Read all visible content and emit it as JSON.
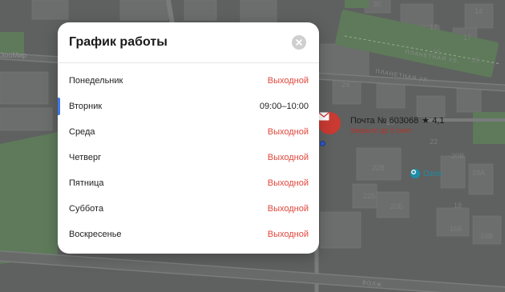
{
  "map": {
    "top_left_label": "ЗооМир",
    "streets": [
      "ПЛАНЕТНАЯ УЛ.",
      "ПЛАНЕТНАЯ УЛ.",
      "ВОЛЖ"
    ],
    "buildings": [
      "30",
      "14",
      "17",
      "17",
      "15",
      "15",
      "24",
      "20",
      "22В",
      "22",
      "20В",
      "18А",
      "22Б",
      "20Б",
      "18",
      "16В",
      "16Б"
    ]
  },
  "poi": {
    "title": "Почта № 603068",
    "rating": "★ 4,1",
    "status": "Закрыто до 2 сент.",
    "icon": "mail-envelope-icon"
  },
  "ozon": {
    "label": "Ozon",
    "icon": "ozon-pin-icon"
  },
  "modal": {
    "title": "График работы",
    "close_icon": "close-icon",
    "days": [
      {
        "day": "Понедельник",
        "time": "Выходной",
        "closed": true,
        "today": false
      },
      {
        "day": "Вторник",
        "time": "09:00–10:00",
        "closed": false,
        "today": true
      },
      {
        "day": "Среда",
        "time": "Выходной",
        "closed": true,
        "today": false
      },
      {
        "day": "Четверг",
        "time": "Выходной",
        "closed": true,
        "today": false
      },
      {
        "day": "Пятница",
        "time": "Выходной",
        "closed": true,
        "today": false
      },
      {
        "day": "Суббота",
        "time": "Выходной",
        "closed": true,
        "today": false
      },
      {
        "day": "Воскресенье",
        "time": "Выходной",
        "closed": true,
        "today": false
      }
    ]
  },
  "colors": {
    "closed_text": "#e0463b",
    "today_marker": "#3b78e7",
    "pin": "#c93a33",
    "ozon": "#1b8ea8"
  }
}
